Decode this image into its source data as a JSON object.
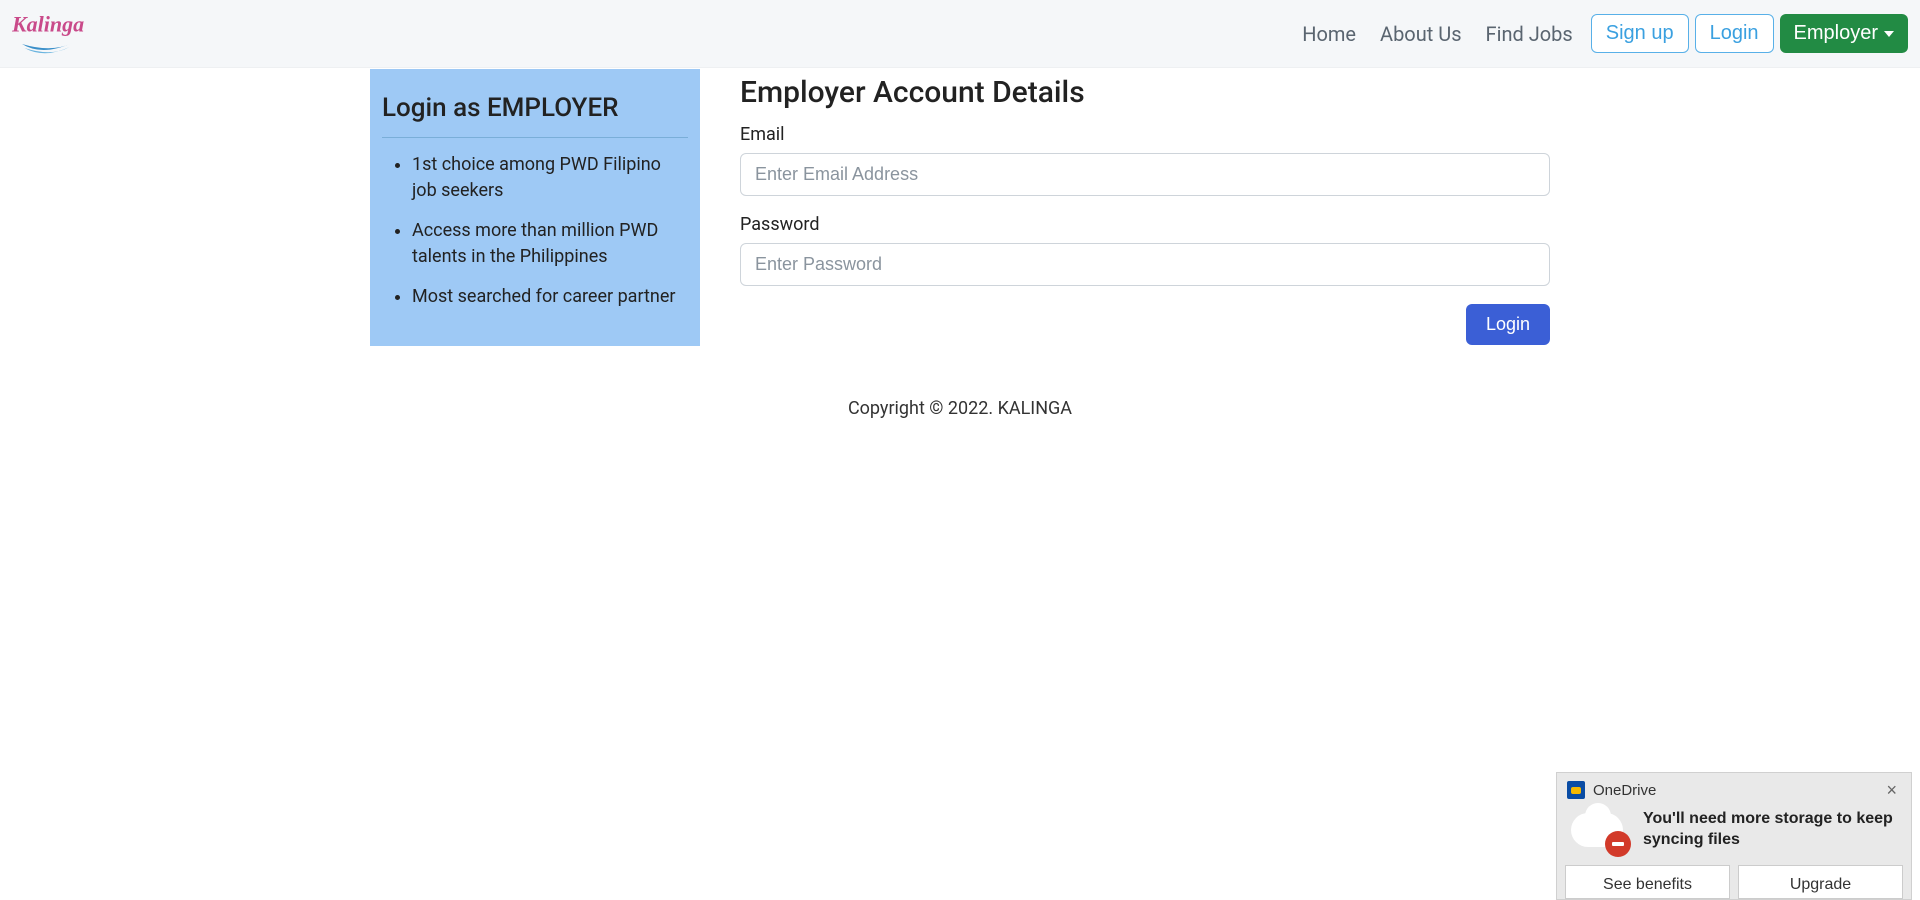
{
  "brand": {
    "name": "Kalinga"
  },
  "nav": {
    "home": "Home",
    "about": "About Us",
    "find_jobs": "Find Jobs",
    "signup": "Sign up",
    "login": "Login",
    "employer": "Employer"
  },
  "sidebar": {
    "heading": "Login as EMPLOYER",
    "points": [
      "1st choice among PWD Filipino job seekers",
      "Access more than million PWD talents in the Philippines",
      "Most searched for career partner"
    ]
  },
  "form": {
    "heading": "Employer Account Details",
    "email_label": "Email",
    "email_placeholder": "Enter Email Address",
    "password_label": "Password",
    "password_placeholder": "Enter Password",
    "submit": "Login"
  },
  "footer": {
    "copyright": "Copyright © 2022. KALINGA"
  },
  "notification": {
    "app": "OneDrive",
    "message": "You'll need more storage to keep syncing files",
    "btn_left": "See benefits",
    "btn_right": "Upgrade"
  }
}
